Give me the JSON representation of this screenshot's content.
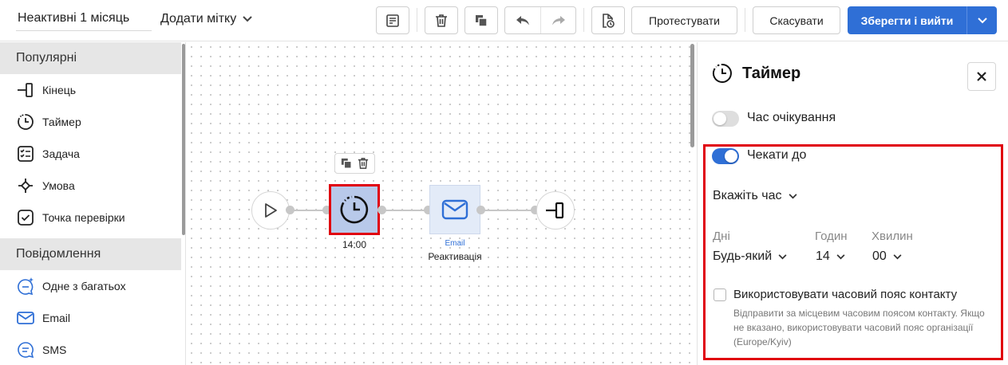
{
  "toolbar": {
    "workflow_name": "Неактивні 1 місяць",
    "add_tag_label": "Додати мітку",
    "test_label": "Протестувати",
    "cancel_label": "Скасувати",
    "save_label": "Зберегти і вийти"
  },
  "palette": {
    "popular_title": "Популярні",
    "popular_items": [
      {
        "label": "Кінець",
        "icon": "end-icon"
      },
      {
        "label": "Таймер",
        "icon": "timer-icon"
      },
      {
        "label": "Задача",
        "icon": "task-list-icon"
      },
      {
        "label": "Умова",
        "icon": "condition-icon"
      },
      {
        "label": "Точка перевірки",
        "icon": "checkpoint-icon"
      }
    ],
    "messages_title": "Повідомлення",
    "message_items": [
      {
        "label": "Одне з багатьох",
        "icon": "sparkle-chat-icon"
      },
      {
        "label": "Email",
        "icon": "email-icon"
      },
      {
        "label": "SMS",
        "icon": "sms-icon"
      }
    ]
  },
  "canvas": {
    "timer_node_label": "14:00",
    "email_node_type": "Email",
    "email_node_label": "Реактивація"
  },
  "panel": {
    "title": "Таймер",
    "wait_time_label": "Час очікування",
    "wait_until_label": "Чекати до",
    "specify_time_label": "Вкажіть час",
    "days_header": "Дні",
    "hours_header": "Годин",
    "minutes_header": "Хвилин",
    "days_value": "Будь-який",
    "hours_value": "14",
    "minutes_value": "00",
    "timezone_label": "Використовувати часовий пояс контакту",
    "timezone_help": "Відправити за місцевим часовим поясом контакту. Якщо не вказано, використовувати часовий пояс організації (Europe/Kyiv)"
  },
  "colors": {
    "accent": "#2f6fd6",
    "highlight": "#e0000f",
    "timer_node_bg": "#b8c9ea",
    "email_node_bg": "#e3ebf8"
  }
}
